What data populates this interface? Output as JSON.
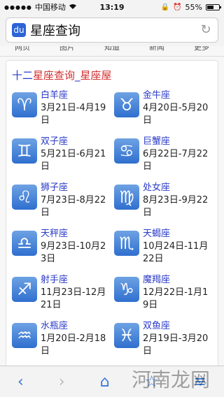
{
  "status": {
    "carrier": "中国移动",
    "time": "13:19",
    "battery": "55%",
    "battery_level": 0.55
  },
  "search": {
    "query": "星座查询"
  },
  "tabs": [
    "网页",
    "图片",
    "知道",
    "新闻",
    "更多"
  ],
  "card": {
    "title_part1": "十二",
    "title_part2": "星座查询",
    "title_sep": "_",
    "title_part3": "星座屋"
  },
  "zodiac": [
    {
      "name": "白羊座",
      "dates": "3月21日-4月19日",
      "icon": "aries-icon",
      "glyph": "♈"
    },
    {
      "name": "金牛座",
      "dates": "4月20日-5月20日",
      "icon": "taurus-icon",
      "glyph": "♉"
    },
    {
      "name": "双子座",
      "dates": "5月21日-6月21日",
      "icon": "gemini-icon",
      "glyph": "♊"
    },
    {
      "name": "巨蟹座",
      "dates": "6月22日-7月22日",
      "icon": "cancer-icon",
      "glyph": "♋"
    },
    {
      "name": "狮子座",
      "dates": "7月23日-8月22日",
      "icon": "leo-icon",
      "glyph": "♌"
    },
    {
      "name": "处女座",
      "dates": "8月23日-9月22日",
      "icon": "virgo-icon",
      "glyph": "♍"
    },
    {
      "name": "天秤座",
      "dates": "9月23日-10月23日",
      "icon": "libra-icon",
      "glyph": "♎"
    },
    {
      "name": "天蝎座",
      "dates": "10月24日-11月22日",
      "icon": "scorpio-icon",
      "glyph": "♏"
    },
    {
      "name": "射手座",
      "dates": "11月23日-12月21日",
      "icon": "sagittarius-icon",
      "glyph": "♐"
    },
    {
      "name": "魔羯座",
      "dates": "12月22日-1月19日",
      "icon": "capricorn-icon",
      "glyph": "♑"
    },
    {
      "name": "水瓶座",
      "dates": "1月20日-2月18日",
      "icon": "aquarius-icon",
      "glyph": "♒"
    },
    {
      "name": "双鱼座",
      "dates": "2月19日-3月20日",
      "icon": "pisces-icon",
      "glyph": "♓"
    }
  ],
  "watermark": "河南龙网",
  "colors": {
    "link": "#2b3bc8",
    "accent": "#d32f2f",
    "icon_bg": "#2f6fcf"
  }
}
